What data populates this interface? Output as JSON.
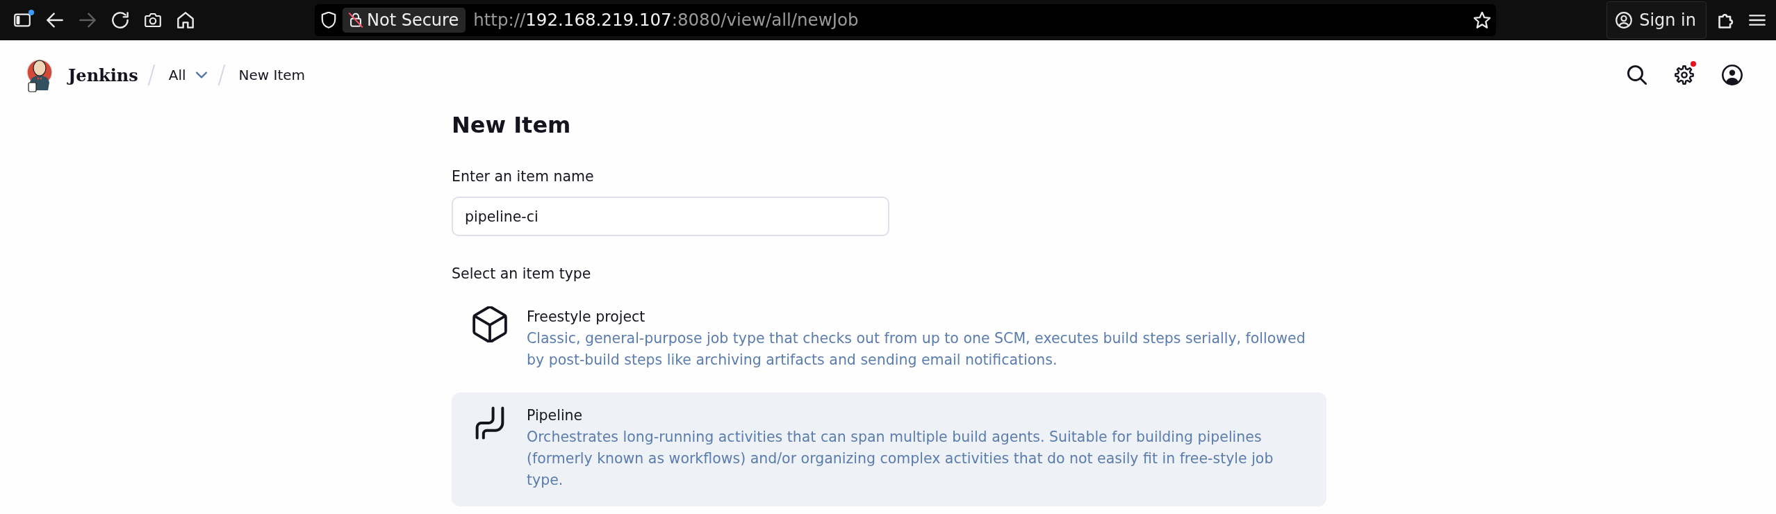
{
  "browser": {
    "sidebar_toggle": {
      "has_notification": true
    },
    "nav_buttons": [
      {
        "kind": "back",
        "disabled": false
      },
      {
        "kind": "forward",
        "disabled": true
      },
      {
        "kind": "reload",
        "disabled": false
      },
      {
        "kind": "screenshot",
        "disabled": false
      },
      {
        "kind": "home",
        "disabled": false
      }
    ],
    "security_label": "Not Secure",
    "url": [
      {
        "text": "http://",
        "emphasis": false
      },
      {
        "text": "192.168.219.107",
        "emphasis": true
      },
      {
        "text": ":8080/view/all/newJob",
        "emphasis": false
      }
    ],
    "sign_in": "Sign in"
  },
  "header": {
    "logo_text": "Jenkins",
    "breadcrumbs": [
      {
        "label": "All",
        "dropdown": true
      },
      {
        "label": "New Item",
        "dropdown": false
      }
    ],
    "settings_notification": true
  },
  "page": {
    "title": "New Item",
    "name_label": "Enter an item name",
    "name_value": "pipeline-ci",
    "type_label": "Select an item type",
    "item_types": [
      {
        "kind": "freestyle",
        "title": "Freestyle project",
        "description": "Classic, general-purpose job type that checks out from up to one SCM, executes build steps serially, followed by post-build steps like archiving artifacts and sending email notifications.",
        "selected": false
      },
      {
        "kind": "pipeline",
        "title": "Pipeline",
        "description": "Orchestrates long-running activities that can span multiple build agents. Suitable for building pipelines (formerly known as workflows) and/or organizing complex activities that do not easily fit in free-style job type.",
        "selected": true
      }
    ]
  }
}
